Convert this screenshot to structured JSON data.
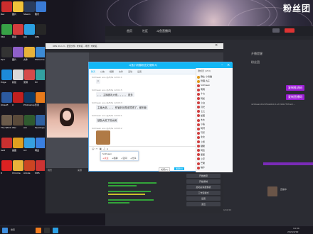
{
  "wallpaper": {
    "title": "粉丝团"
  },
  "desktop": {
    "icons": [
      {
        "label": "Rec",
        "color": "#cc2d2d"
      },
      {
        "label": "图片",
        "color": "#f1c33a"
      },
      {
        "label": "Steam",
        "color": "#2a3d5e"
      },
      {
        "label": "腾讯",
        "color": "#3a7bd5"
      },
      {
        "label": "360",
        "color": "#37a146"
      },
      {
        "label": "网易",
        "color": "#d43d3d"
      },
      {
        "label": "QQ",
        "color": "#2b9fe0"
      },
      {
        "label": "OBS",
        "color": "#262626"
      },
      {
        "label": "Epic",
        "color": "#333"
      },
      {
        "label": "图片",
        "color": "#8f60c9"
      },
      {
        "label": "文件",
        "color": "#e8b23a"
      },
      {
        "label": "WeGame",
        "color": "#3d8bd5"
      },
      {
        "label": "Edge",
        "color": "#1d8ad8"
      },
      {
        "label": "新建",
        "color": "#d9d9d9"
      },
      {
        "label": "录屏",
        "color": "#d64a4a"
      },
      {
        "label": "EV",
        "color": "#33a0a0"
      },
      {
        "label": "Ubisoft",
        "color": "#2c5aa0"
      },
      {
        "label": "X",
        "color": "#c02020"
      },
      {
        "label": "Photoshop",
        "color": "#0f3a66"
      },
      {
        "label": "影音",
        "color": "#e87a1a"
      },
      {
        "label": "The Witch",
        "color": "#6b5b4b"
      },
      {
        "label": "War",
        "color": "#5a4a3a"
      },
      {
        "label": "Ark",
        "color": "#2f5a2f"
      },
      {
        "label": "TeamSpeak",
        "color": "#3060a0"
      },
      {
        "label": "Sett",
        "color": "#c93030"
      },
      {
        "label": "画图",
        "color": "#e0a020"
      },
      {
        "label": "UU",
        "color": "#36a0e0"
      },
      {
        "label": "网盘",
        "color": "#3b80e0"
      },
      {
        "label": "R",
        "color": "#d22"
      },
      {
        "label": "Chrome",
        "color": "#e9b23a"
      },
      {
        "label": "Adobe",
        "color": "#c42"
      },
      {
        "label": "WPS",
        "color": "#cc3333"
      }
    ]
  },
  "browser": {
    "nav": [
      "首页",
      "社区",
      "斗鱼直播间"
    ],
    "side": [
      "开播提醒",
      "粉丝团",
      "1146"
    ],
    "code": "4294ea2d22d54a0b0c1a7c96b7f0f1e8 ...",
    "buttons": [
      "复制推流码",
      "复制直播码"
    ],
    "status": "直播中",
    "footer": "2024/04/29"
  },
  "obs": {
    "title": "OBS 29.1.3 - 配置文件: 未命名 - 场景: 未命名",
    "scenes_label": "场景",
    "sources_label": "来源",
    "mixer_label": "混音器",
    "controls_label": "控件",
    "controls": [
      "开始推流",
      "开始录制",
      "启动虚拟摄像机",
      "工作室模式",
      "设置",
      "退出"
    ]
  },
  "chat": {
    "title": "斗鱼小奶猫粉丝交流群(3)",
    "tabs": [
      "聊天",
      "公告",
      "相册",
      "文件",
      "活动",
      "设置"
    ],
    "messages": [
      {
        "meta": "Sidmean ace  @/P/ta 12:01:1",
        "text": "?"
      },
      {
        "meta": "Sidmean ace  @/P/ta 12:01:5",
        "text": "。。  主播被乳大佬。。。。 更多"
      },
      {
        "meta": "Sidmean ace  @/P/ta 12:03:3",
        "text": "主播大佬。。。   别管好还是谁骂得了，都别管"
      },
      {
        "meta": "Sidmean ace  @/P/ta 12:04:1",
        "text": "鼓励大佬了别太刷"
      },
      {
        "meta": "Sidmean ace  @/P/ta 12:05:2",
        "text": "[图片]"
      }
    ],
    "input_placeholder": "",
    "send_label": "发送(S)",
    "close_label": "关闭(C)",
    "popup": [
      "Sidmean",
      "+关注",
      "+私聊",
      "+空间",
      "+分享"
    ],
    "members_title": "群成员 (153)",
    "members": [
      "群主 小奶猫",
      "管理 丸子",
      "Sidmean",
      "南雨",
      "十七",
      "阿凯",
      "小白",
      "月光",
      "七七",
      "饭团",
      "木木",
      "小鱼",
      "阿轩",
      "可乐",
      "北北",
      "小熊",
      "糖果",
      "阿哲",
      "星星",
      "小宇",
      "芒果",
      "柚子"
    ]
  },
  "taskbar": {
    "time": "14:34",
    "date": "2024/4/29",
    "labels": [
      "搜索",
      "斗鱼",
      "OBS",
      "QQ"
    ]
  }
}
